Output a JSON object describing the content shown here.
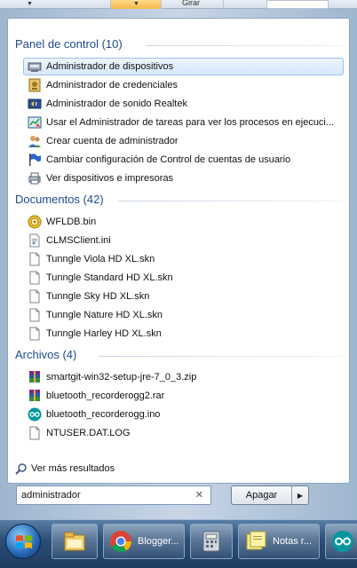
{
  "toolbar": {
    "girar_label": "Girar"
  },
  "groups": {
    "panel": {
      "title": "Panel de control (10)",
      "items": [
        {
          "label": "Administrador de dispositivos",
          "icon": "device-manager-icon",
          "selected": true
        },
        {
          "label": "Administrador de credenciales",
          "icon": "credential-manager-icon"
        },
        {
          "label": "Administrador de sonido Realtek",
          "icon": "realtek-audio-icon"
        },
        {
          "label": "Usar el Administrador de tareas para ver los procesos en ejecuci...",
          "icon": "task-manager-icon"
        },
        {
          "label": "Crear cuenta de administrador",
          "icon": "user-accounts-icon"
        },
        {
          "label": "Cambiar configuración de Control de cuentas de usuario",
          "icon": "uac-flag-icon"
        },
        {
          "label": "Ver dispositivos e impresoras",
          "icon": "devices-printers-icon"
        }
      ]
    },
    "documentos": {
      "title": "Documentos (42)",
      "items": [
        {
          "label": "WFLDB.bin",
          "icon": "bin-file-icon"
        },
        {
          "label": "CLMSClient.ini",
          "icon": "ini-file-icon"
        },
        {
          "label": "Tunngle Viola HD XL.skn",
          "icon": "blank-file-icon"
        },
        {
          "label": "Tunngle Standard HD XL.skn",
          "icon": "blank-file-icon"
        },
        {
          "label": "Tunngle Sky HD XL.skn",
          "icon": "blank-file-icon"
        },
        {
          "label": "Tunngle Nature HD XL.skn",
          "icon": "blank-file-icon"
        },
        {
          "label": "Tunngle Harley HD XL.skn",
          "icon": "blank-file-icon"
        }
      ]
    },
    "archivos": {
      "title": "Archivos (4)",
      "items": [
        {
          "label": "smartgit-win32-setup-jre-7_0_3.zip",
          "icon": "winrar-archive-icon"
        },
        {
          "label": "bluetooth_recorderogg2.rar",
          "icon": "winrar-archive-icon"
        },
        {
          "label": "bluetooth_recorderogg.ino",
          "icon": "arduino-file-icon"
        },
        {
          "label": "NTUSER.DAT.LOG",
          "icon": "blank-file-icon"
        }
      ]
    }
  },
  "more_results": "Ver más resultados",
  "search": {
    "value": "administrador"
  },
  "shutdown": {
    "label": "Apagar"
  },
  "taskbar": {
    "buttons": [
      {
        "label": "",
        "icon": "file-explorer-icon"
      },
      {
        "label": "Blogger...",
        "icon": "chrome-icon"
      },
      {
        "label": "",
        "icon": "calculator-icon"
      },
      {
        "label": "Notas r...",
        "icon": "sticky-notes-icon"
      },
      {
        "label": "",
        "icon": "arduino-icon"
      }
    ]
  },
  "colors": {
    "group_heading": "#1f4a8a",
    "selection": "#d7e7fb",
    "taskbar": "#2c4f77"
  }
}
